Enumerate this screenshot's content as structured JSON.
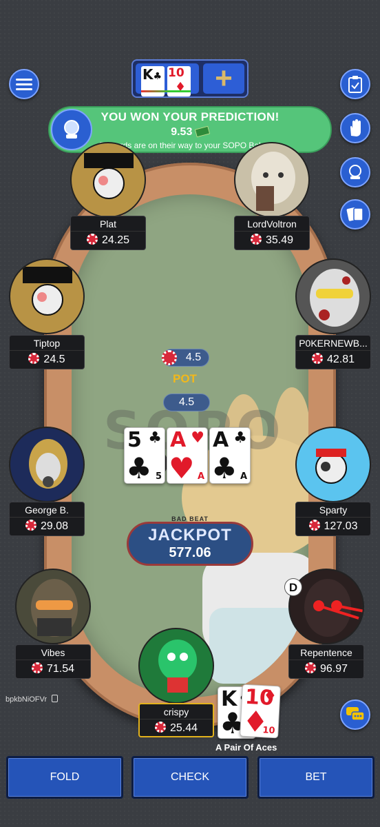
{
  "banner": {
    "title": "YOU WON YOUR PREDICTION!",
    "amount": "9.53",
    "subtitle": "Rewards are on their way to your SOPO Balance."
  },
  "watermark": "SOPO",
  "hand_preview": {
    "card1_rank": "K",
    "card2_rank": "10",
    "plus": "+"
  },
  "players": {
    "plat": {
      "name": "Plat",
      "stack": "24.25"
    },
    "lordvoltron": {
      "name": "LordVoltron",
      "stack": "35.49"
    },
    "tiptop": {
      "name": "Tiptop",
      "stack": "24.5"
    },
    "pokernewb": {
      "name": "P0KERNEWB...",
      "stack": "42.81"
    },
    "george": {
      "name": "George B.",
      "stack": "29.08"
    },
    "sparty": {
      "name": "Sparty",
      "stack": "127.03"
    },
    "vibes": {
      "name": "Vibes",
      "stack": "71.54"
    },
    "repentence": {
      "name": "Repentence",
      "stack": "96.97"
    },
    "crispy": {
      "name": "crispy",
      "stack": "25.44"
    }
  },
  "pot": {
    "bet": "4.5",
    "label": "POT",
    "total": "4.5"
  },
  "board": [
    {
      "rank": "5",
      "suit": "♣",
      "color": "black"
    },
    {
      "rank": "A",
      "suit": "♥",
      "color": "red"
    },
    {
      "rank": "A",
      "suit": "♣",
      "color": "black"
    }
  ],
  "hero_cards": [
    {
      "rank": "K",
      "suit": "♣",
      "color": "black"
    },
    {
      "rank": "10",
      "suit": "♦",
      "color": "red"
    }
  ],
  "jackpot": {
    "small": "BAD BEAT",
    "title": "JACKPOT",
    "value": "577.06"
  },
  "hand_description": "A Pair Of Aces",
  "dealer_label": "D",
  "user_id": "bpkbNiOFVr",
  "actions": {
    "fold": "FOLD",
    "check": "CHECK",
    "bet": "BET"
  },
  "colors": {
    "accent": "#2a5fd1",
    "felt": "#8fa582",
    "rail": "#c88f67",
    "banner": "#55c57a",
    "pot_label": "#f2b81b"
  }
}
